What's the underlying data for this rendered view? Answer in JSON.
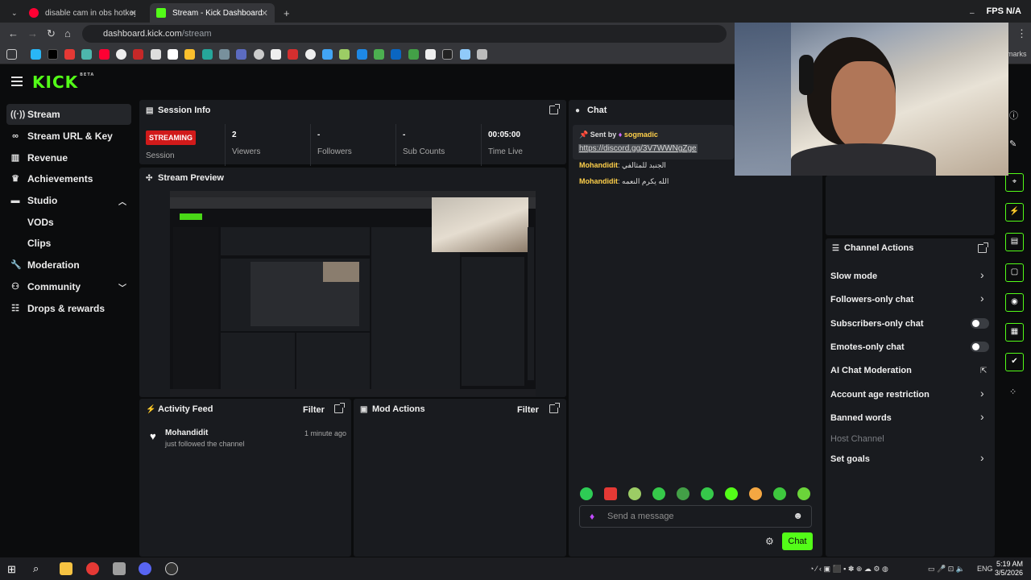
{
  "browser": {
    "tabs": [
      {
        "title": "disable cam in obs hotkey - You",
        "active": false
      },
      {
        "title": "Stream - Kick Dashboard",
        "active": true
      }
    ],
    "address": {
      "host": "dashboard.kick.com",
      "path": "/stream"
    },
    "fps_label": "FPS",
    "fps_value": "N/A",
    "bookmarks_label": "marks"
  },
  "app": {
    "logo": "KICK",
    "logo_sup": "BETA",
    "accent": "#53fc18"
  },
  "sidebar": {
    "items": [
      {
        "label": "Stream",
        "icon": "stream-icon"
      },
      {
        "label": "Stream URL & Key",
        "icon": "link-icon"
      },
      {
        "label": "Revenue",
        "icon": "revenue-icon"
      },
      {
        "label": "Achievements",
        "icon": "trophy-icon"
      },
      {
        "label": "Studio",
        "icon": "studio-icon"
      },
      {
        "label": "VODs",
        "icon": ""
      },
      {
        "label": "Clips",
        "icon": ""
      },
      {
        "label": "Moderation",
        "icon": "wrench-icon"
      },
      {
        "label": "Community",
        "icon": "community-icon"
      },
      {
        "label": "Drops & rewards",
        "icon": "drops-icon"
      }
    ]
  },
  "session": {
    "title": "Session Info",
    "status": "STREAMING",
    "session_label": "Session",
    "viewers_value": "2",
    "viewers_label": "Viewers",
    "followers_value": "-",
    "followers_label": "Followers",
    "subs_value": "-",
    "subs_label": "Sub Counts",
    "time_value": "00:05:00",
    "time_label": "Time Live"
  },
  "preview": {
    "title": "Stream Preview"
  },
  "activity": {
    "title": "Activity Feed",
    "filter": "Filter",
    "items": [
      {
        "user": "Mohandidit",
        "text": "just followed the channel",
        "time": "1 minute ago"
      }
    ]
  },
  "mod_actions": {
    "title": "Mod Actions",
    "filter": "Filter"
  },
  "chat": {
    "title": "Chat",
    "pinned_prefix": "Sent by",
    "pinned_user": "sogmadic",
    "pinned_link": "https://discord.gg/3V7WWNgZge",
    "messages": [
      {
        "user": "Mohandidit",
        "text": "الجنبد للمثالفي"
      },
      {
        "user": "Mohandidit",
        "text": "الله يكرم النعمه"
      }
    ],
    "placeholder": "Send a message",
    "send_label": "Chat"
  },
  "channel_actions": {
    "title": "Channel Actions",
    "items": [
      {
        "label": "Slow mode",
        "control": "chevron"
      },
      {
        "label": "Followers-only chat",
        "control": "chevron"
      },
      {
        "label": "Subscribers-only chat",
        "control": "toggle"
      },
      {
        "label": "Emotes-only chat",
        "control": "toggle"
      },
      {
        "label": "AI Chat Moderation",
        "control": "external"
      },
      {
        "label": "Account age restriction",
        "control": "chevron"
      },
      {
        "label": "Banned words",
        "control": "chevron"
      },
      {
        "label": "Host Channel",
        "control": "none"
      },
      {
        "label": "Set goals",
        "control": "chevron"
      }
    ]
  },
  "taskbar": {
    "lang": "ENG",
    "time": "5:19 AM",
    "date": "3/5/2026"
  }
}
